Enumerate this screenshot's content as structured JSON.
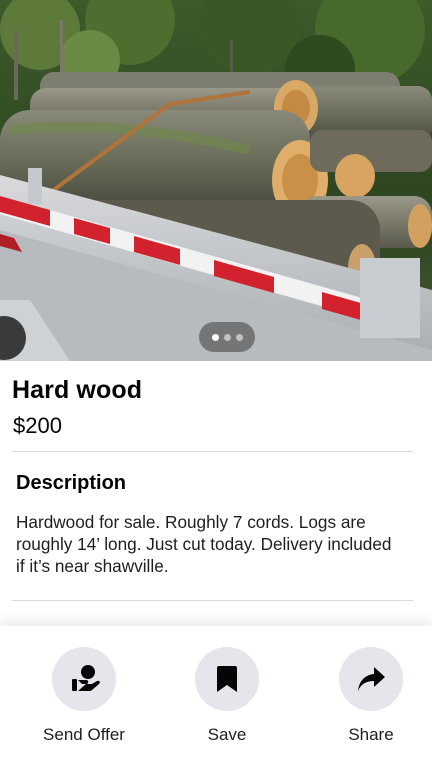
{
  "listing": {
    "title": "Hard wood",
    "price": "$200",
    "photo_icon": "log-pile-on-trailer-photo"
  },
  "gallery": {
    "dot_count": 3,
    "active_index": 0
  },
  "description": {
    "heading": "Description",
    "text": "Hardwood for sale. Roughly 7 cords. Logs are roughly 14’ long. Just cut today. Delivery included if it’s near shawville."
  },
  "actions": [
    {
      "label": "Send Offer",
      "icon": "send-offer-icon"
    },
    {
      "label": "Save",
      "icon": "bookmark-icon"
    },
    {
      "label": "Share",
      "icon": "share-arrow-icon"
    }
  ],
  "colors": {
    "action_circle": "#e4e6eb",
    "divider": "#d6dadf",
    "text": "#050505"
  }
}
